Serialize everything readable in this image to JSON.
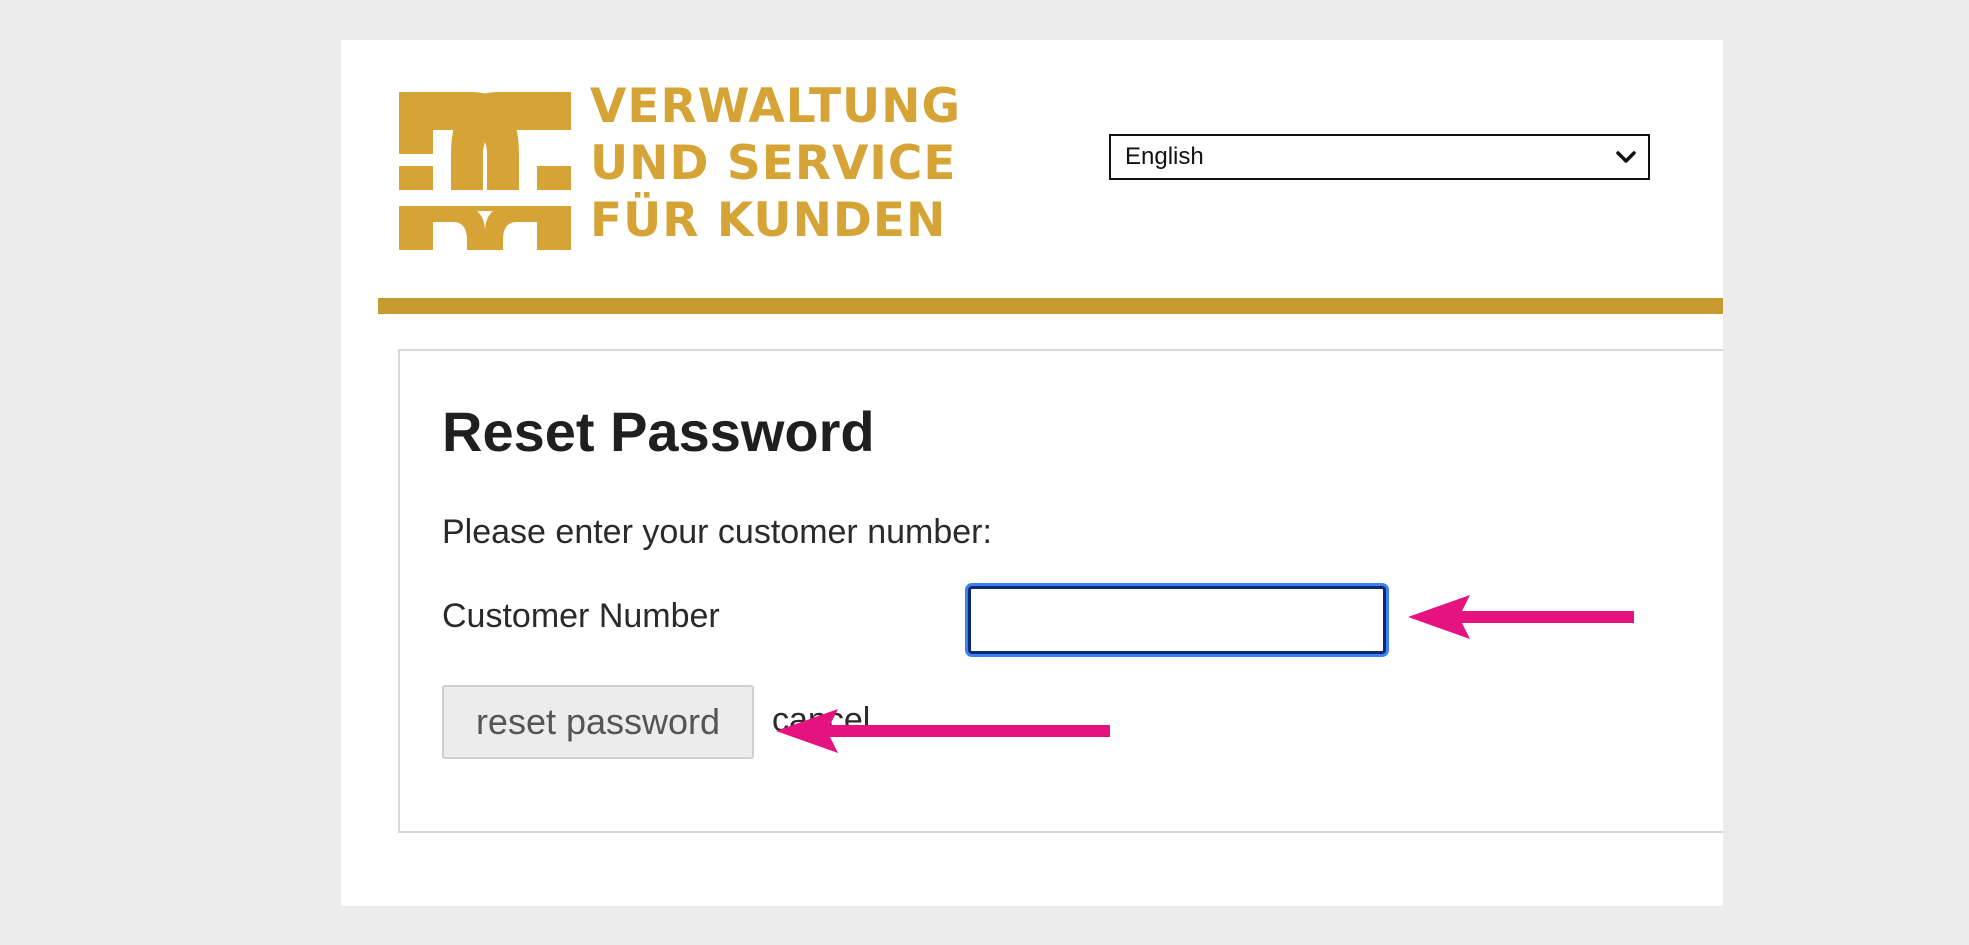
{
  "brand": {
    "lines": [
      "VERWALTUNG",
      "UND SERVICE",
      "FÜR KUNDEN"
    ],
    "color": "#d6a436"
  },
  "language_select": {
    "selected": "English",
    "icon": "chevron-down-icon"
  },
  "accent_bar_color": "#c69a2e",
  "form": {
    "title": "Reset Password",
    "instruction": "Please enter your customer number:",
    "customer_number_label": "Customer Number",
    "customer_number_value": "",
    "reset_button_label": "reset password",
    "cancel_label": "cancel"
  },
  "annotations": {
    "arrow_color": "#e5137f"
  }
}
